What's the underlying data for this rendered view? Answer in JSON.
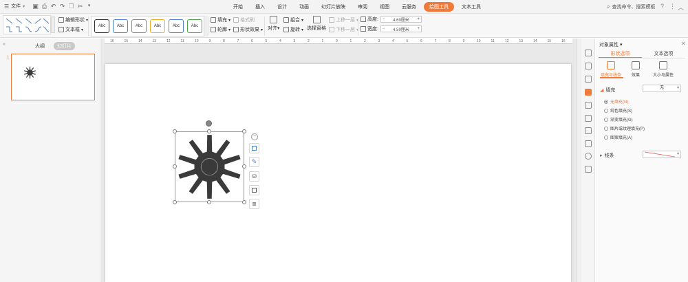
{
  "menu": {
    "file_label": "文件",
    "tabs": [
      {
        "label": "开始"
      },
      {
        "label": "插入"
      },
      {
        "label": "设计"
      },
      {
        "label": "动画"
      },
      {
        "label": "幻灯片放映"
      },
      {
        "label": "审阅"
      },
      {
        "label": "视图"
      },
      {
        "label": "云服务"
      },
      {
        "label": "绘图工具",
        "active": true
      },
      {
        "label": "文本工具"
      }
    ],
    "search_label": "查找命令、搜索模板"
  },
  "ribbon": {
    "edit_shape": "编辑形状",
    "text_box": "文本框",
    "style_buttons": [
      "Abc",
      "Abc",
      "Abc",
      "Abc",
      "Abc",
      "Abc"
    ],
    "style_colors": [
      "#333333",
      "#4a86c8",
      "#8a8a8a",
      "#f0b21e",
      "#4a86c8",
      "#4aa84a"
    ],
    "fill": "填充",
    "outline": "轮廓",
    "format_painter": "格式刷",
    "shape_effect": "形状效果",
    "align": "对齐",
    "group": "组合",
    "rotate": "旋转",
    "selection_pane": "选择窗格",
    "bring_forward": "上移一层",
    "send_backward": "下移一层",
    "height_label": "高度:",
    "height_value": "4.69厘米",
    "width_label": "宽度:",
    "width_value": "4.59厘米"
  },
  "left_panel": {
    "tab_outline": "大纲",
    "tab_slides": "幻灯片",
    "slide_number": "1"
  },
  "ruler": {
    "labels": [
      "16",
      "15",
      "14",
      "13",
      "12",
      "11",
      "10",
      "9",
      "8",
      "7",
      "6",
      "5",
      "4",
      "3",
      "2",
      "1",
      "0",
      "1",
      "2",
      "3",
      "4",
      "5",
      "6",
      "7",
      "8",
      "9",
      "10",
      "11",
      "12",
      "13",
      "14",
      "15",
      "16"
    ]
  },
  "props": {
    "title": "对象属性",
    "tab_shape": "形状选项",
    "tab_text": "文本选项",
    "sub_fill_line": "填充与线条",
    "sub_effects": "效果",
    "sub_size": "大小与属性",
    "fill_section": "填充",
    "fill_value": "无",
    "fill_options": [
      {
        "label": "无填充(N)",
        "checked": true
      },
      {
        "label": "纯色填充(S)",
        "checked": false
      },
      {
        "label": "渐变填充(G)",
        "checked": false
      },
      {
        "label": "图片或纹理填充(P)",
        "checked": false
      },
      {
        "label": "图案填充(A)",
        "checked": false
      }
    ],
    "line_section": "线条"
  },
  "colors": {
    "accent": "#f07a3a",
    "gear": "#3a3a3a"
  }
}
